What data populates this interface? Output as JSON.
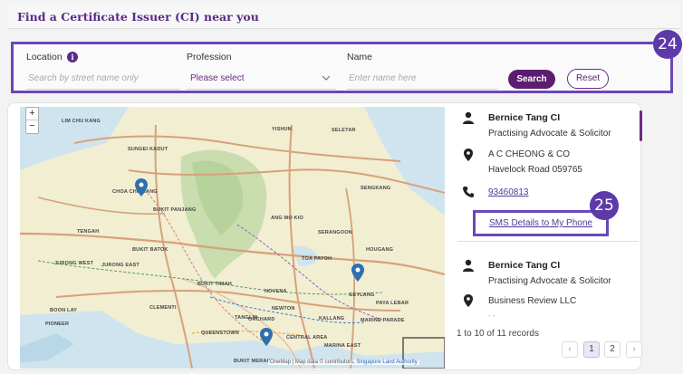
{
  "title": "Find a Certificate Issuer (CI) near you",
  "filters": {
    "location_label": "Location",
    "location_info": "i",
    "location_placeholder": "Search by street name only",
    "profession_label": "Profession",
    "profession_value": "Please select",
    "name_label": "Name",
    "name_placeholder": "Enter name here",
    "search_label": "Search",
    "reset_label": "Reset"
  },
  "badges": {
    "filters": "24",
    "sms": "25"
  },
  "map": {
    "zoom_in": "+",
    "zoom_out": "−",
    "places": [
      "LIM CHU KANG",
      "SUNGEI KADUT",
      "CHOA CHU KANG",
      "BUKIT PANJANG",
      "BUKIT BATOK",
      "JURONG WEST",
      "JURONG EAST",
      "BOON LAY",
      "PIONEER",
      "CLEMENTI",
      "BUKIT TIMAH",
      "QUEENSTOWN",
      "TANGLIN",
      "NOVENA",
      "TOA PAYOH",
      "SERANGOON",
      "ANG MO KIO",
      "YISHUN",
      "SELETAR",
      "SENGKANG",
      "HOUGANG",
      "PAYA LEBAR",
      "GEYLANG",
      "ORCHARD",
      "NEWTON",
      "KALLANG",
      "CENTRAL AREA",
      "MARINA EAST",
      "MARINE PARADE",
      "BUKIT MERAH",
      "TENGAH"
    ],
    "attribution_prefix": "OneMap | Map data © contributors,",
    "attribution_link": "Singapore Land Authority"
  },
  "results": [
    {
      "name": "Bernice Tang CI",
      "profession": "Practising Advocate & Solicitor",
      "firm": "A C CHEONG & CO",
      "address": "Havelock Road 059765",
      "phone": "93460813",
      "sms": "SMS Details to My Phone"
    },
    {
      "name": "Bernice Tang CI",
      "profession": "Practising Advocate & Solicitor",
      "firm": "Business Review LLC",
      "address": "- -"
    }
  ],
  "pagination": {
    "records": "1 to 10 of 11 records",
    "pages": [
      "1",
      "2"
    ],
    "prev": "‹",
    "next": "›"
  },
  "colors": {
    "accent": "#5b2a86",
    "badge": "#5d3aa8",
    "highlight_border": "#6a48b8"
  }
}
